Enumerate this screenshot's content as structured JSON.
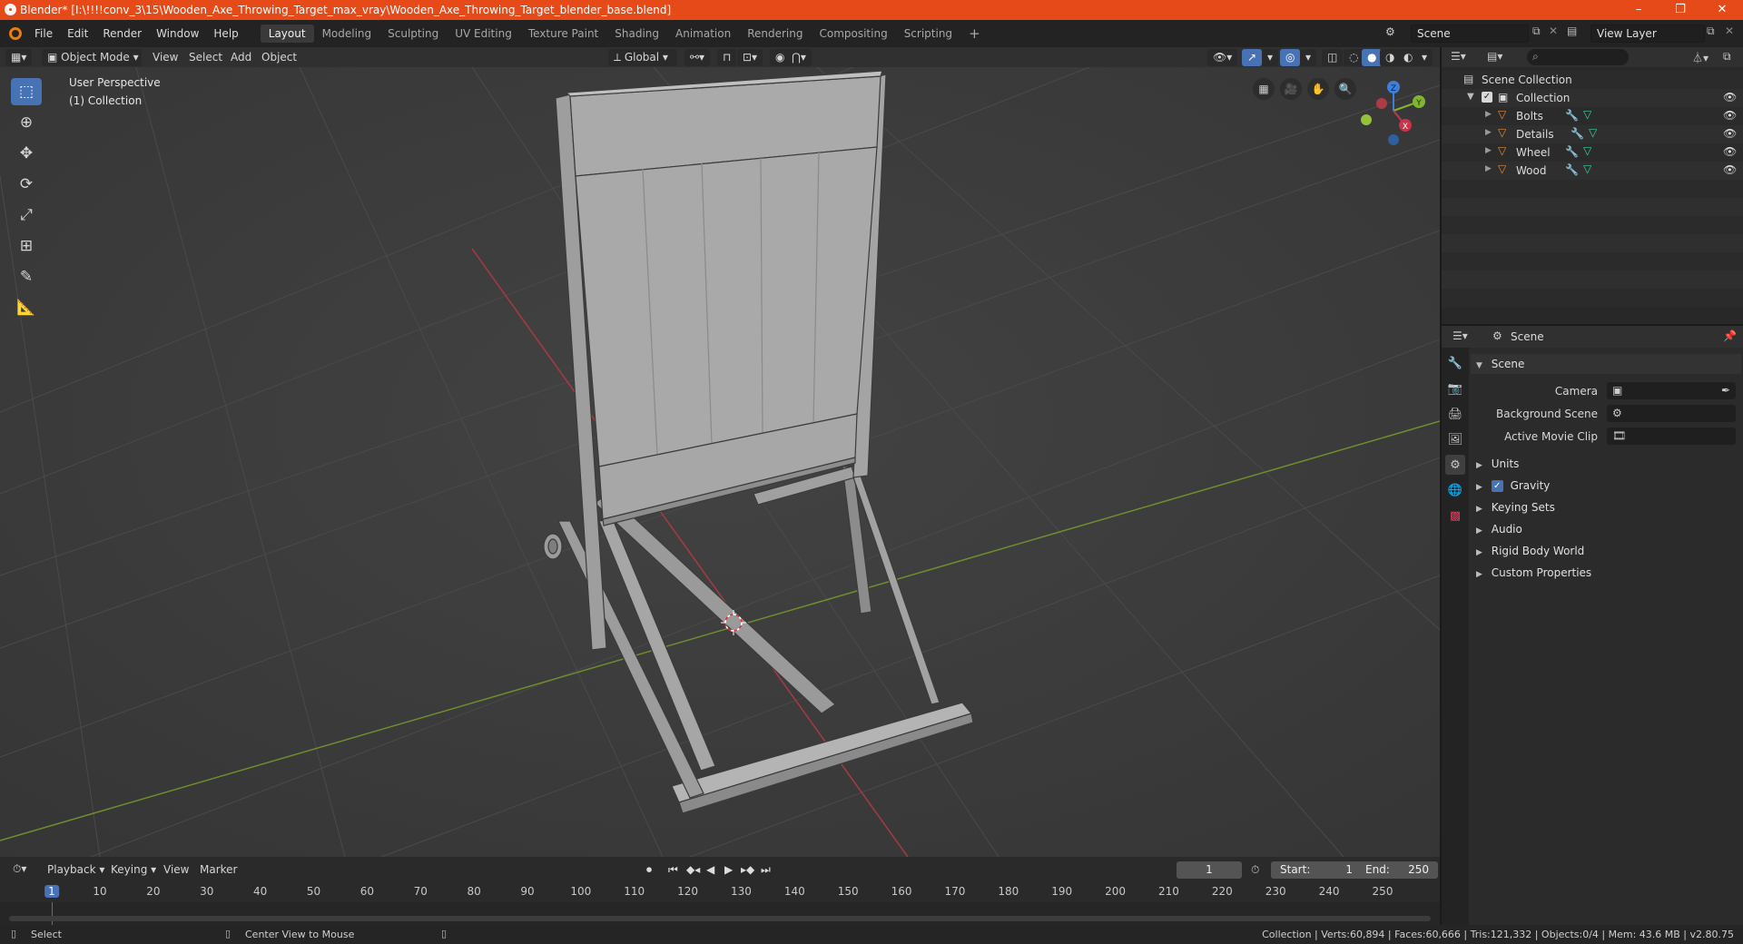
{
  "window": {
    "title": "Blender* [I:\\!!!!conv_3\\15\\Wooden_Axe_Throwing_Target_max_vray\\Wooden_Axe_Throwing_Target_blender_base.blend]",
    "minimize": "–",
    "maximize": "❐",
    "close": "✕"
  },
  "menus": [
    "File",
    "Edit",
    "Render",
    "Window",
    "Help"
  ],
  "workspaces": [
    "Layout",
    "Modeling",
    "Sculpting",
    "UV Editing",
    "Texture Paint",
    "Shading",
    "Animation",
    "Rendering",
    "Compositing",
    "Scripting"
  ],
  "add_workspace": "+",
  "scene_field": "Scene",
  "view_layer_field": "View Layer",
  "viewport_header": {
    "mode": "Object Mode",
    "menus": [
      "View",
      "Select",
      "Add",
      "Object"
    ],
    "orientation": "Global"
  },
  "viewport_overlay": {
    "view_name": "User Perspective",
    "collection": "(1) Collection"
  },
  "gizmo": {
    "x": "X",
    "y": "Y",
    "z": "Z"
  },
  "outliner": {
    "root": "Scene Collection",
    "collection": "Collection",
    "items": [
      "Bolts",
      "Details",
      "Wheel",
      "Wood"
    ]
  },
  "properties": {
    "header_title": "Scene",
    "panel_title": "Scene",
    "camera_label": "Camera",
    "background_scene_label": "Background Scene",
    "active_movie_clip_label": "Active Movie Clip",
    "sections": [
      "Units",
      "Gravity",
      "Keying Sets",
      "Audio",
      "Rigid Body World",
      "Custom Properties"
    ],
    "gravity_enabled": true
  },
  "timeline": {
    "menus": [
      "Playback",
      "Keying",
      "View",
      "Marker"
    ],
    "current_frame": "1",
    "start_label": "Start:",
    "start": "1",
    "end_label": "End:",
    "end": "250",
    "ruler_ticks": [
      "1",
      "10",
      "20",
      "30",
      "40",
      "50",
      "60",
      "70",
      "80",
      "90",
      "100",
      "110",
      "120",
      "130",
      "140",
      "150",
      "160",
      "170",
      "180",
      "190",
      "200",
      "210",
      "220",
      "230",
      "240",
      "250"
    ]
  },
  "statusbar": {
    "select": "Select",
    "center_view": "Center View to Mouse",
    "stats": "Collection | Verts:60,894 | Faces:60,666 | Tris:121,332 | Objects:0/4 | Mem: 43.6 MB | v2.80.75"
  },
  "colors": {
    "titlebar": "#e64a19",
    "accent": "#4772b3",
    "x_axis": "#c8354a",
    "y_axis": "#7fb532",
    "z_axis": "#3f7fdc"
  }
}
